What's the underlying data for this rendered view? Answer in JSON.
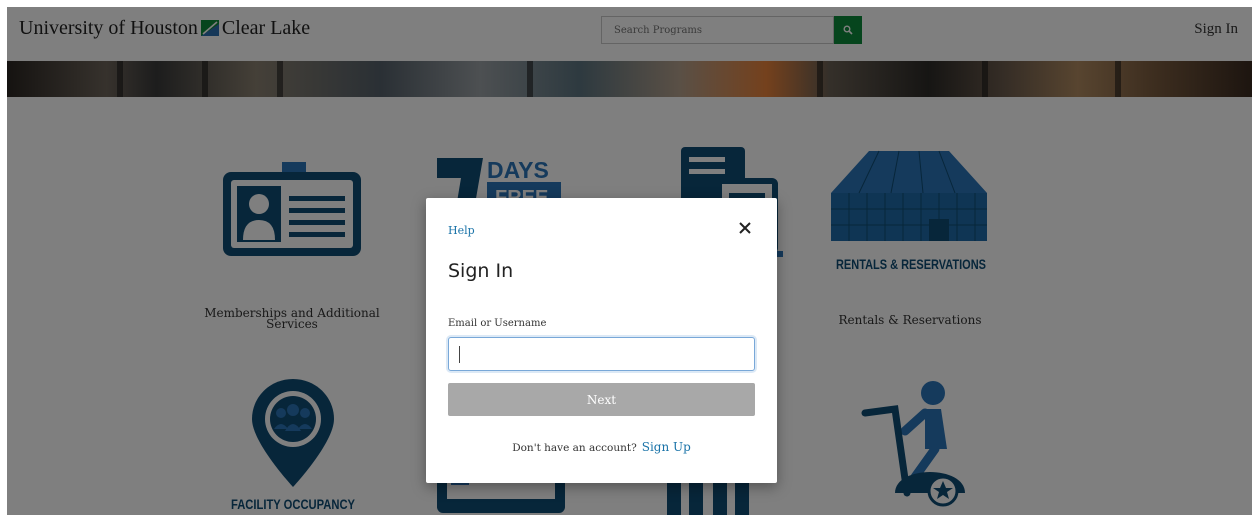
{
  "header": {
    "logo_text_left": "University of Houston",
    "logo_text_right": "Clear Lake",
    "search_placeholder": "Search Programs",
    "sign_in_label": "Sign In"
  },
  "tiles": [
    {
      "label": "Memberships and Additional Services",
      "icon": "id-card-icon"
    },
    {
      "label": "",
      "icon": "seven-days-free-icon",
      "graphic_text": [
        "DAYS",
        "FREE"
      ]
    },
    {
      "label": "",
      "icon": "document-icon"
    },
    {
      "label": "Rentals & Reservations",
      "icon": "building-icon",
      "graphic_text": "RENTALS & RESERVATIONS"
    },
    {
      "label": "",
      "icon": "map-pin-people-icon",
      "graphic_text": "FACILITY OCCUPANCY"
    },
    {
      "label": "",
      "icon": "tablet-icon"
    },
    {
      "label": "",
      "icon": "chair-icon"
    },
    {
      "label": "",
      "icon": "exercise-bike-icon"
    }
  ],
  "modal": {
    "help_label": "Help",
    "title": "Sign In",
    "email_label": "Email or Username",
    "email_value": "",
    "next_label": "Next",
    "signup_prompt": "Don't have an account?",
    "signup_label": "Sign Up"
  },
  "colors": {
    "brand_green": "#0c8a3a",
    "icon_blue": "#0f4c75",
    "link_blue": "#1a73a8",
    "button_disabled": "#a8a8a8",
    "overlay": "rgba(0,0,0,0.5)"
  }
}
